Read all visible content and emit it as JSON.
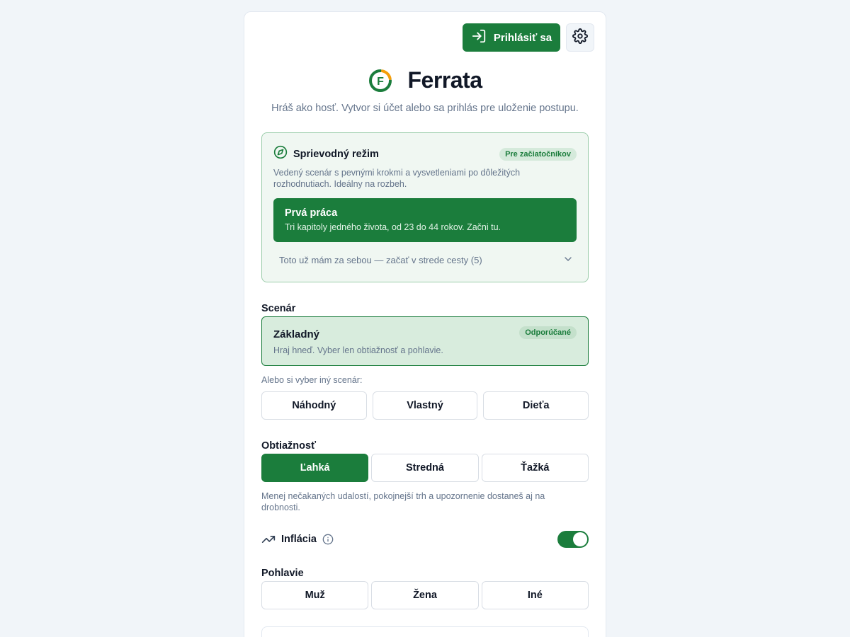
{
  "header": {
    "login_label": "Prihlásiť sa",
    "login_icon": "login-arrow-icon",
    "settings_icon": "gear-icon"
  },
  "brand": {
    "name": "Ferrata",
    "logo_letter": "F",
    "logo_colors": {
      "green": "#1b7d3c",
      "orange": "#f59e0b"
    }
  },
  "subtitle": "Hráš ako hosť. Vytvor si účet alebo sa prihlás pre uloženie postupu.",
  "guided": {
    "title": "Sprievodný režim",
    "badge": "Pre začiatočníkov",
    "icon": "compass-icon",
    "description": "Vedený scenár s pevnými krokmi a vysvetleniami po dôležitých rozhodnutiach. Ideálny na rozbeh.",
    "first_job": {
      "title": "Prvá práca",
      "subtitle": "Tri kapitoly jedného života, od 23 do 44 rokov. Začni tu."
    },
    "midway_label": "Toto už mám za sebou — začať v strede cesty (5)"
  },
  "scenario": {
    "label": "Scenár",
    "selected": {
      "title": "Základný",
      "badge": "Odporúčané",
      "description": "Hraj hneď. Vyber len obtiažnosť a pohlavie."
    },
    "other_label": "Alebo si vyber iný scenár:",
    "options": [
      "Náhodný",
      "Vlastný",
      "Dieťa"
    ]
  },
  "difficulty": {
    "label": "Obtiažnosť",
    "options": [
      "Ľahká",
      "Stredná",
      "Ťažká"
    ],
    "selected": "Ľahká",
    "description": "Menej nečakaných udalostí, pokojnejší trh a upozornenie dostaneš aj na drobnosti."
  },
  "inflation": {
    "label": "Inflácia",
    "icon": "trending-up-icon",
    "info_icon": "info-icon",
    "enabled": true
  },
  "gender": {
    "label": "Pohlavie",
    "options": [
      "Muž",
      "Žena",
      "Iné"
    ]
  },
  "colors": {
    "accent": "#1b7d3c",
    "accent_light": "#d8ecdd",
    "muted_text": "#64748b",
    "background": "#f1f5f9"
  }
}
